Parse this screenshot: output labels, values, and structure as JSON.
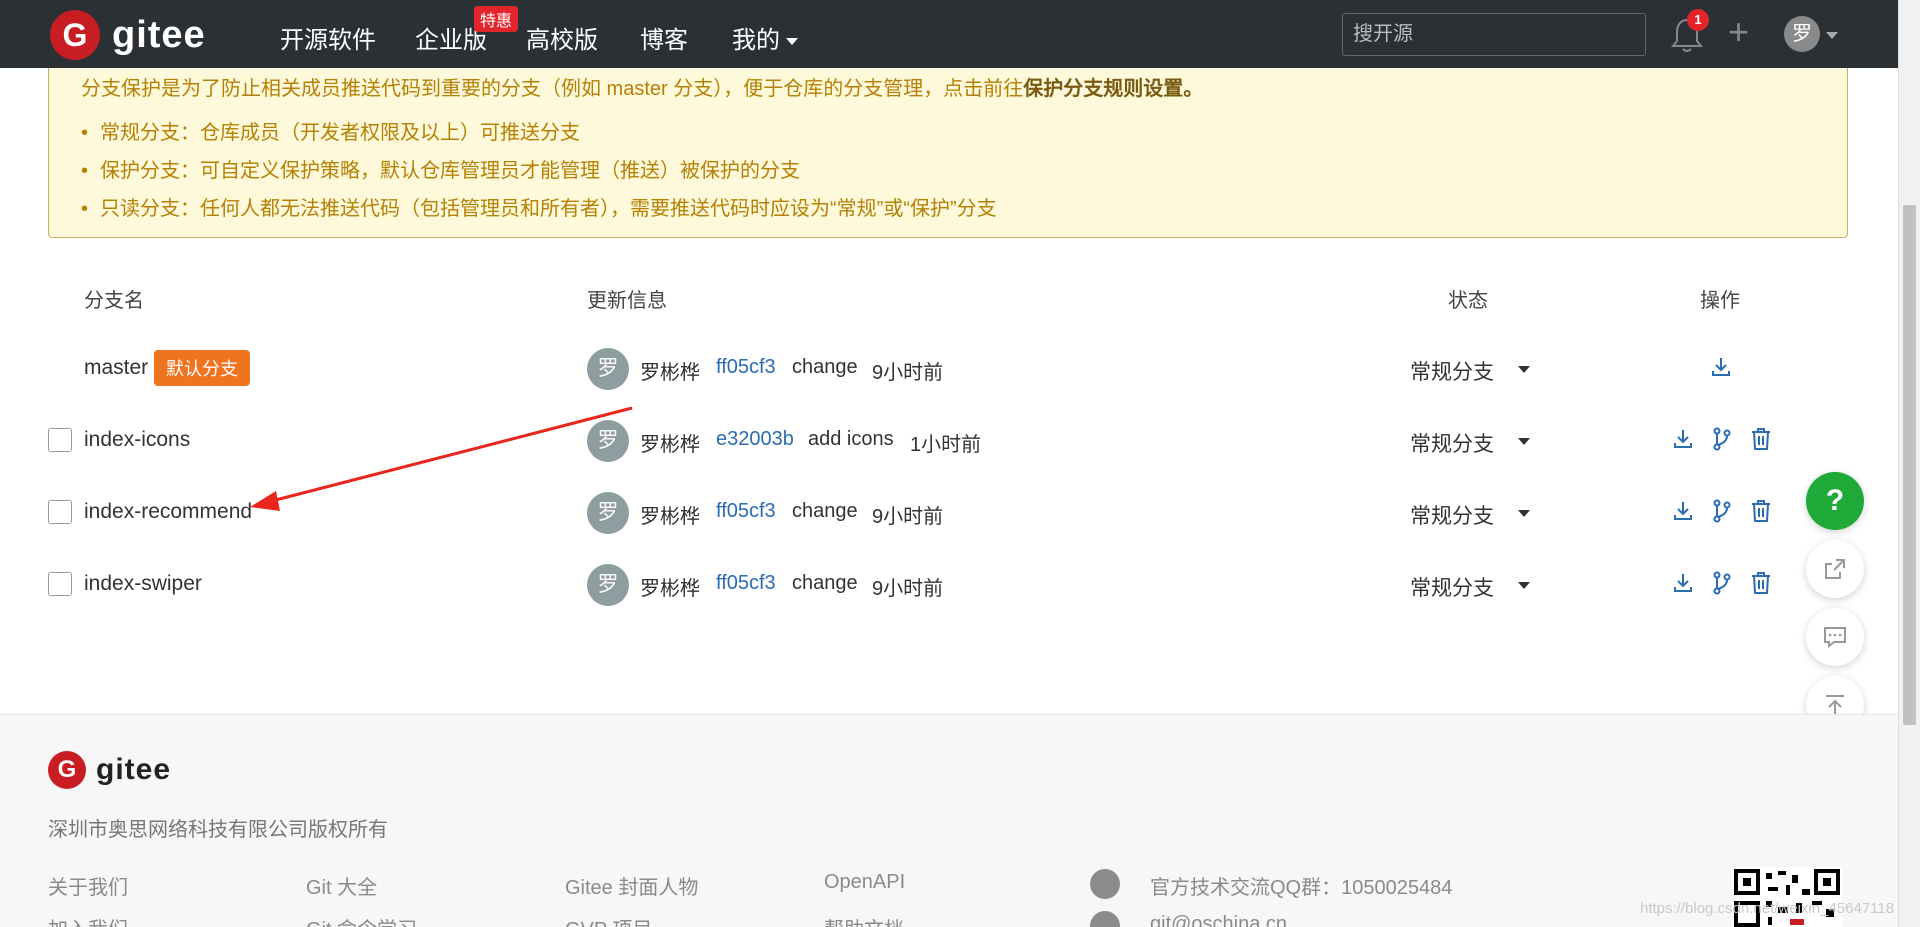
{
  "nav": {
    "logo": "gitee",
    "items": [
      "开源软件",
      "企业版",
      "高校版",
      "博客",
      "我的"
    ],
    "promo_badge": "特惠",
    "search_placeholder": "搜开源",
    "notification_count": "1",
    "user_avatar": "罗"
  },
  "notice": {
    "intro": "分支保护是为了防止相关成员推送代码到重要的分支（例如 master 分支），便于仓库的分支管理，点击前往",
    "link": "保护分支规则设置。",
    "bullets": [
      "常规分支：仓库成员（开发者权限及以上）可推送分支",
      "保护分支：可自定义保护策略，默认仓库管理员才能管理（推送）被保护的分支",
      "只读分支：任何人都无法推送代码（包括管理员和所有者），需要推送代码时应设为“常规”或“保护”分支"
    ]
  },
  "table": {
    "headers": [
      "分支名",
      "更新信息",
      "状态",
      "操作"
    ],
    "default_badge": "默认分支",
    "rows": [
      {
        "name": "master",
        "avatar": "罗",
        "author": "罗彬桦",
        "sha": "ff05cf3",
        "message": "change",
        "time": "9小时前",
        "status": "常规分支"
      },
      {
        "name": "index-icons",
        "avatar": "罗",
        "author": "罗彬桦",
        "sha": "e32003b",
        "message": "add icons",
        "time": "1小时前",
        "status": "常规分支"
      },
      {
        "name": "index-recommend",
        "avatar": "罗",
        "author": "罗彬桦",
        "sha": "ff05cf3",
        "message": "change",
        "time": "9小时前",
        "status": "常规分支"
      },
      {
        "name": "index-swiper",
        "avatar": "罗",
        "author": "罗彬桦",
        "sha": "ff05cf3",
        "message": "change",
        "time": "9小时前",
        "status": "常规分支"
      }
    ]
  },
  "floating": {
    "help": "?"
  },
  "footer": {
    "logo": "gitee",
    "copyright": "深圳市奥思网络科技有限公司版权所有",
    "col1": [
      "关于我们",
      "加入我们"
    ],
    "col2": [
      "Git 大全",
      "Git 命令学习"
    ],
    "col3": [
      "Gitee 封面人物",
      "GVP 项目"
    ],
    "col4": [
      "OpenAPI",
      "帮助文档"
    ],
    "qq_group": "官方技术交流QQ群：1050025484",
    "email": "git@oschina.cn"
  },
  "watermark": "https://blog.csdn.net/weixin_45647118",
  "colors": {
    "nav_bg": "#2b3035",
    "accent_red": "#c71d23",
    "link_blue": "#2b6cb0",
    "badge_orange": "#f0731f",
    "notice_bg": "#fff9db",
    "help_green": "#1fa939"
  }
}
